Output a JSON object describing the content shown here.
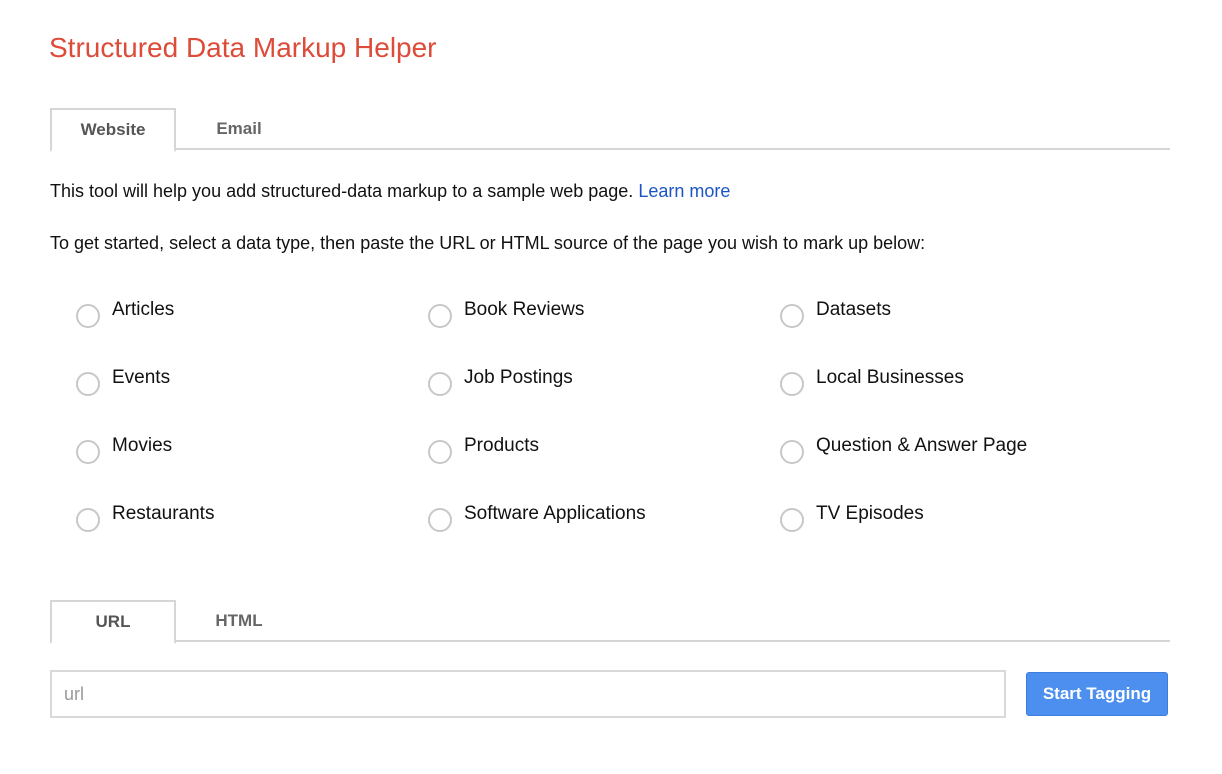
{
  "header": {
    "title": "Structured Data Markup Helper"
  },
  "top_tabs": [
    {
      "label": "Website",
      "active": true
    },
    {
      "label": "Email",
      "active": false
    }
  ],
  "intro": {
    "text": "This tool will help you add structured-data markup to a sample web page.",
    "link_label": "Learn more"
  },
  "instructions": "To get started, select a data type, then paste the URL or HTML source of the page you wish to mark up below:",
  "data_types": [
    {
      "label": "Articles",
      "selected": false
    },
    {
      "label": "Book Reviews",
      "selected": false
    },
    {
      "label": "Datasets",
      "selected": false
    },
    {
      "label": "Events",
      "selected": false
    },
    {
      "label": "Job Postings",
      "selected": false
    },
    {
      "label": "Local Businesses",
      "selected": false
    },
    {
      "label": "Movies",
      "selected": false
    },
    {
      "label": "Products",
      "selected": false
    },
    {
      "label": "Question & Answer Page",
      "selected": false
    },
    {
      "label": "Restaurants",
      "selected": false
    },
    {
      "label": "Software Applications",
      "selected": false
    },
    {
      "label": "TV Episodes",
      "selected": false
    }
  ],
  "source_tabs": [
    {
      "label": "URL",
      "active": true
    },
    {
      "label": "HTML",
      "active": false
    }
  ],
  "url_input": {
    "value": "",
    "placeholder": "url"
  },
  "start_button": {
    "label": "Start Tagging"
  },
  "colors": {
    "title": "#dd4b39",
    "link": "#1a55c5",
    "button": "#4d8fef"
  }
}
